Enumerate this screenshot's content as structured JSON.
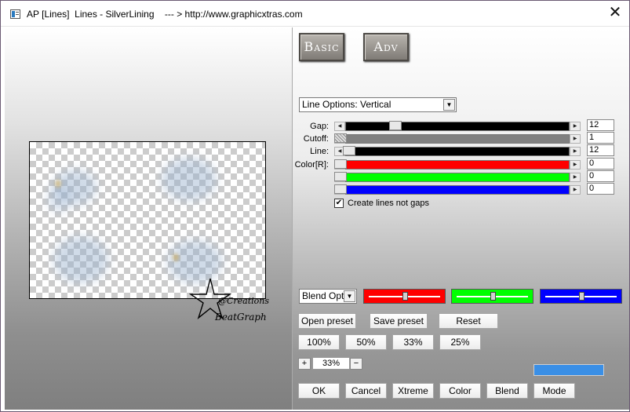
{
  "window": {
    "title": "AP [Lines]  Lines - SilverLining    --- > http://www.graphicxtras.com",
    "close_glyph": "✕"
  },
  "mode_buttons": {
    "basic": "Basic",
    "adv": "Adv"
  },
  "line_options": {
    "selected": "Line Options: Vertical"
  },
  "sliders": {
    "gap": {
      "label": "Gap:",
      "value": "12",
      "position": 0.26,
      "track_color": "#000000"
    },
    "cutoff": {
      "label": "Cutoff:",
      "value": "1",
      "position": 0.0,
      "track_color": "#7f7f7f"
    },
    "line": {
      "label": "Line:",
      "value": "12",
      "position": 0.04,
      "track_color": "#000000"
    },
    "color_r": {
      "label": "Color[R]:",
      "value": "0",
      "position": 0.0,
      "track_color": "#ff0000"
    },
    "color_g": {
      "label": "",
      "value": "0",
      "position": 0.0,
      "track_color": "#00ff00"
    },
    "color_b": {
      "label": "",
      "value": "0",
      "position": 0.0,
      "track_color": "#0000ff"
    }
  },
  "create_lines": {
    "label": "Create lines not gaps",
    "checked": true
  },
  "blend": {
    "selected": "Blend Optio",
    "red": {
      "color": "#ff0000",
      "position": 0.5
    },
    "green": {
      "color": "#00ff00",
      "position": 0.5
    },
    "blue": {
      "color": "#0000ff",
      "position": 0.5
    }
  },
  "presets": {
    "open": "Open preset",
    "save": "Save preset",
    "reset": "Reset"
  },
  "zoom_presets": [
    "100%",
    "50%",
    "33%",
    "25%"
  ],
  "zoom": {
    "plus": "+",
    "value": "33%",
    "minus": "−"
  },
  "preview_color": "#3a8fe6",
  "bottom_buttons": [
    "OK",
    "Cancel",
    "Xtreme",
    "Color",
    "Blend",
    "Mode"
  ],
  "watermark": {
    "line1": "@Creations",
    "line2": "BeatGraph"
  }
}
